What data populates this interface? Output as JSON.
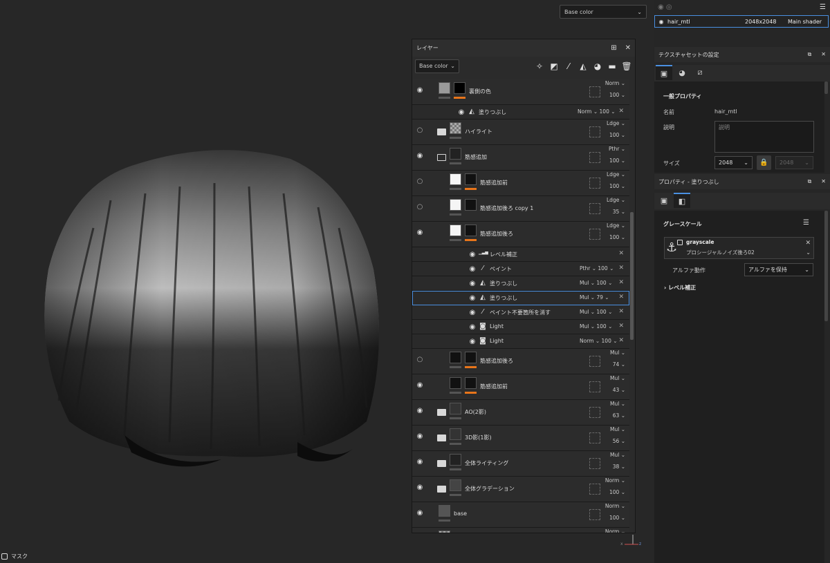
{
  "viewport": {
    "channel_select": "Base color",
    "mask_label": "マスク",
    "axis_labels": {
      "x": "x",
      "z": "z"
    }
  },
  "layers_panel": {
    "title": "レイヤー",
    "channel_select": "Base color",
    "tool_icons": [
      "magic-wand-icon",
      "add-mask-icon",
      "paint-brush-icon",
      "fill-icon",
      "filter-icon",
      "folder-icon",
      "trash-icon"
    ],
    "rows": [
      {
        "kind": "layer",
        "name": "裏側の色",
        "visible": true,
        "blend": "Norm",
        "opacity": "100",
        "folder": false,
        "thumb": "#9a9a9a",
        "mask": "#000",
        "orange": true
      },
      {
        "kind": "effect",
        "name": "塗りつぶし",
        "visible": true,
        "blend": "Norm",
        "opacity": "100",
        "icon": "fill-icon",
        "indent": 1
      },
      {
        "kind": "layer",
        "name": "ハイライト",
        "visible": false,
        "blend": "Ldge",
        "opacity": "100",
        "folder": true,
        "thumb": "checker",
        "orange": false
      },
      {
        "kind": "layer",
        "name": "筋感追加",
        "visible": true,
        "blend": "Pthr",
        "opacity": "100",
        "folder": "open",
        "thumb": "#222",
        "orange": false
      },
      {
        "kind": "layer",
        "name": "筋感追加前",
        "visible": false,
        "blend": "Ldge",
        "opacity": "100",
        "folder": false,
        "thumb": "#f5f5f5",
        "mask": "#111",
        "orange": true,
        "indent": 1
      },
      {
        "kind": "layer",
        "name": "筋感追加後ろ copy 1",
        "visible": false,
        "blend": "Ldge",
        "opacity": "35",
        "folder": false,
        "thumb": "#f5f5f5",
        "mask": "#111",
        "orange": false,
        "indent": 1
      },
      {
        "kind": "layer",
        "name": "筋感追加後ろ",
        "visible": true,
        "blend": "Ldge",
        "opacity": "100",
        "folder": false,
        "thumb": "#f5f5f5",
        "mask": "#111",
        "orange": true,
        "indent": 1
      },
      {
        "kind": "effect",
        "name": "レベル補正",
        "visible": true,
        "blend": "",
        "opacity": "",
        "icon": "levels-icon",
        "indent": 2
      },
      {
        "kind": "effect",
        "name": "ペイント",
        "visible": true,
        "blend": "Pthr",
        "opacity": "100",
        "icon": "brush-icon",
        "indent": 2
      },
      {
        "kind": "effect",
        "name": "塗りつぶし",
        "visible": true,
        "blend": "Mul",
        "opacity": "100",
        "icon": "fill-icon",
        "indent": 2
      },
      {
        "kind": "effect",
        "name": "塗りつぶし",
        "visible": true,
        "blend": "Mul",
        "opacity": "79",
        "icon": "fill-icon",
        "indent": 2,
        "active": true
      },
      {
        "kind": "effect",
        "name": "ペイント不要箇所を消す",
        "visible": true,
        "blend": "Mul",
        "opacity": "100",
        "icon": "brush-icon",
        "indent": 2
      },
      {
        "kind": "effect",
        "name": "Light",
        "visible": true,
        "blend": "Mul",
        "opacity": "100",
        "icon": "generator-icon",
        "indent": 2
      },
      {
        "kind": "effect",
        "name": "Light",
        "visible": true,
        "blend": "Norm",
        "opacity": "100",
        "icon": "generator-icon",
        "indent": 2
      },
      {
        "kind": "layer",
        "name": "筋感追加後ろ",
        "visible": false,
        "blend": "Mul",
        "opacity": "74",
        "folder": false,
        "thumb": "#111",
        "mask": "#111",
        "orange": true,
        "indent": 1
      },
      {
        "kind": "layer",
        "name": "筋感追加前",
        "visible": true,
        "blend": "Mul",
        "opacity": "43",
        "folder": false,
        "thumb": "#111",
        "mask": "#111",
        "orange": true,
        "indent": 1
      },
      {
        "kind": "layer",
        "name": "AO(2影)",
        "visible": true,
        "blend": "Mul",
        "opacity": "63",
        "folder": true,
        "thumb": "#333",
        "orange": false
      },
      {
        "kind": "layer",
        "name": "3D影(1影)",
        "visible": true,
        "blend": "Mul",
        "opacity": "56",
        "folder": true,
        "thumb": "#333",
        "orange": false
      },
      {
        "kind": "layer",
        "name": "全体ライティング",
        "visible": true,
        "blend": "Mul",
        "opacity": "38",
        "folder": true,
        "thumb": "#222",
        "orange": false
      },
      {
        "kind": "layer",
        "name": "全体グラデーション",
        "visible": true,
        "blend": "Norm",
        "opacity": "100",
        "folder": true,
        "thumb": "#444",
        "orange": false
      },
      {
        "kind": "layer",
        "name": "base",
        "visible": true,
        "blend": "Norm",
        "opacity": "100",
        "folder": false,
        "thumb": "#555",
        "orange": false
      },
      {
        "kind": "layer",
        "name": "",
        "visible": false,
        "blend": "Norm",
        "opacity": "",
        "folder": false,
        "thumb": "checker",
        "orange": false,
        "partial": true
      }
    ]
  },
  "texture_set_list": {
    "material": {
      "name": "hair_mtl",
      "size": "2048x2048",
      "shader": "Main shader"
    }
  },
  "texture_set_settings": {
    "title": "テクスチャセットの設定",
    "section": "一般プロパティ",
    "name_label": "名前",
    "name_value": "hair_mtl",
    "desc_label": "説明",
    "desc_placeholder": "説明",
    "size_label": "サイズ",
    "size_value": "2048",
    "size_value_locked": "2048"
  },
  "properties": {
    "title": "プロパティ - 塗りつぶし",
    "section": "グレースケール",
    "resource_name": "grayscale",
    "resource_sub": "プロシージャルノイズ後ろ02",
    "alpha_label": "アルファ動作",
    "alpha_value": "アルファを保持",
    "levels_label": "レベル補正"
  },
  "colors": {
    "accent": "#4a90e2",
    "orange": "#e8751a",
    "bg": "#262626"
  }
}
